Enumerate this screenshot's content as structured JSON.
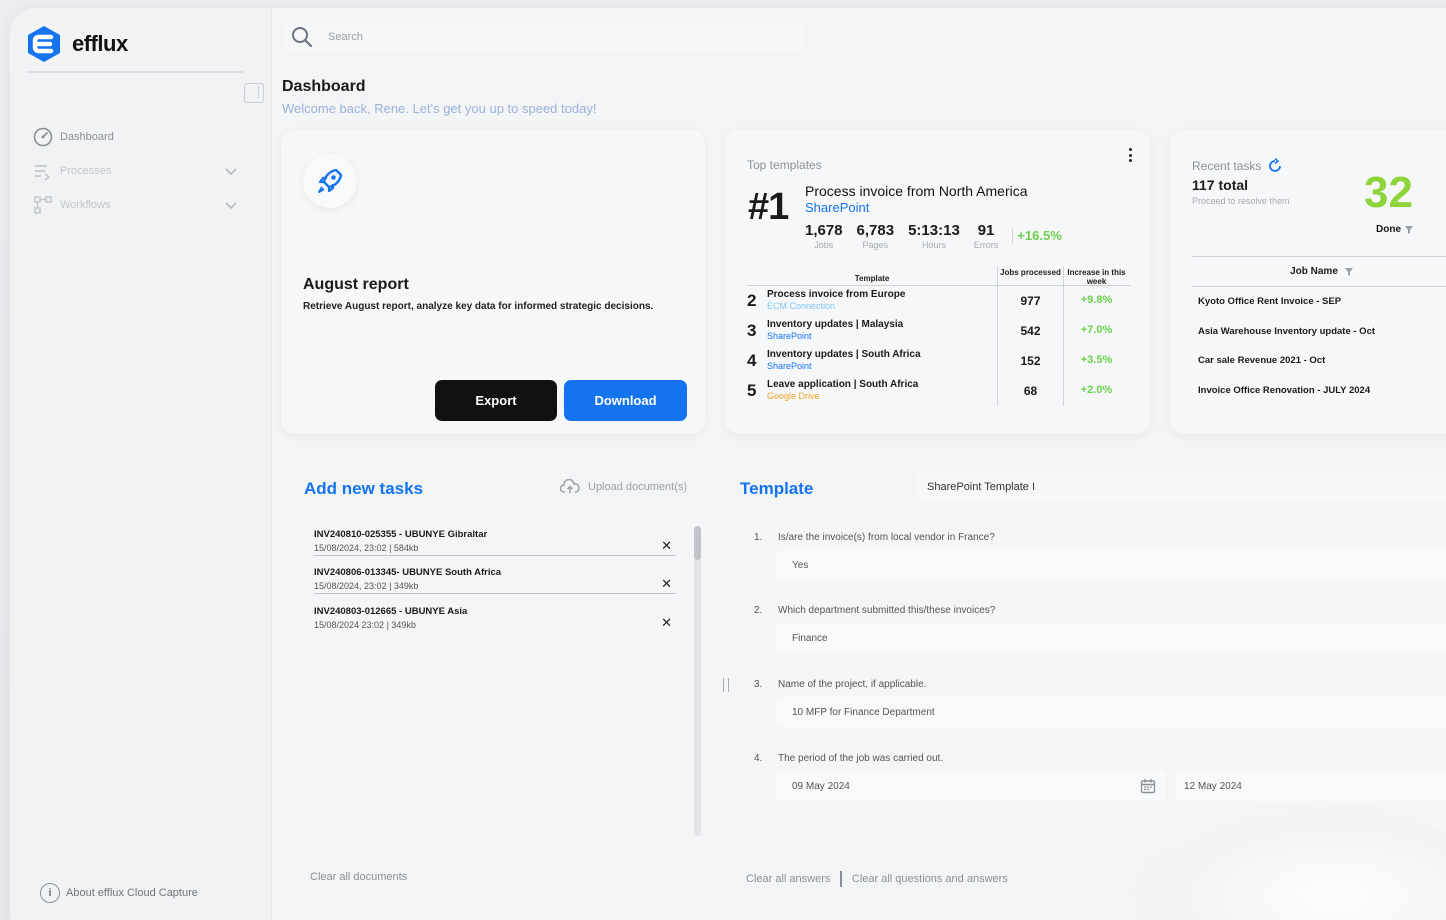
{
  "app": {
    "name": "efflux"
  },
  "colors": {
    "brand": "#1474f0",
    "accent_green": "#8ed43a",
    "increase_green": "#6bd14c",
    "dark_button": "#111111"
  },
  "sidebar": {
    "items": [
      {
        "label": "Dashboard",
        "icon": "dashboard-icon"
      },
      {
        "label": "Processes",
        "icon": "processes-icon"
      },
      {
        "label": "Workflows",
        "icon": "workflows-icon"
      }
    ],
    "about": "About efflux Cloud Capture"
  },
  "search": {
    "placeholder": "Search"
  },
  "header": {
    "title": "Dashboard",
    "subtitle": "Welcome back, Rene. Let's get you up to speed today!"
  },
  "report": {
    "title": "August report",
    "description": "Retrieve August report, analyze key data for informed strategic decisions.",
    "export_label": "Export",
    "download_label": "Download"
  },
  "top_templates": {
    "label": "Top templates",
    "top": {
      "rank": "#1",
      "name": "Process invoice from North America",
      "source": "SharePoint",
      "stats": [
        {
          "value": "1,678",
          "label": "Jobs"
        },
        {
          "value": "6,783",
          "label": "Pages"
        },
        {
          "value": "5:13:13",
          "label": "Hours"
        },
        {
          "value": "91",
          "label": "Errors"
        }
      ],
      "increase": "+16.5%"
    },
    "columns": {
      "template": "Template",
      "jobs": "Jobs processed",
      "increase": "Increase in this week"
    },
    "rows": [
      {
        "rank": "2",
        "name": "Process invoice from Europe",
        "source": "ECM Connection",
        "source_color": "#7fc4f0",
        "jobs": "977",
        "increase": "+9.8%"
      },
      {
        "rank": "3",
        "name": "Inventory updates | Malaysia",
        "source": "SharePoint",
        "source_color": "#1474f0",
        "jobs": "542",
        "increase": "+7.0%"
      },
      {
        "rank": "4",
        "name": "Inventory updates | South Africa",
        "source": "SharePoint",
        "source_color": "#1474f0",
        "jobs": "152",
        "increase": "+3.5%"
      },
      {
        "rank": "5",
        "name": "Leave application | South Africa",
        "source": "Google Drive",
        "source_color": "#f0a623",
        "jobs": "68",
        "increase": "+2.0%"
      }
    ]
  },
  "recent_tasks": {
    "label": "Recent tasks",
    "total": "117 total",
    "subtitle": "Proceed to resolve them",
    "done_count": "32",
    "done_label": "Done",
    "column": "Job Name",
    "rows": [
      "Kyoto Office Rent Invoice - SEP",
      "Asia Warehouse Inventory update - Oct",
      "Car sale Revenue 2021 - Oct",
      "Invoice Office Renovation - JULY 2024"
    ]
  },
  "add_tasks": {
    "title": "Add new tasks",
    "upload_label": "Upload document(s)",
    "documents": [
      {
        "name": "INV240810-025355 - UBUNYE Gibraltar",
        "meta": "15/08/2024, 23:02 | 584kb"
      },
      {
        "name": "INV240806-013345- UBUNYE South Africa",
        "meta": "15/08/2024, 23:02 | 349kb"
      },
      {
        "name": "INV240803-012665 - UBUNYE Asia",
        "meta": "15/08/2024 23:02 | 349kb"
      }
    ],
    "clear_label": "Clear all documents"
  },
  "template_panel": {
    "title": "Template",
    "selected": "SharePoint Template I",
    "questions": [
      {
        "num": "1.",
        "text": "Is/are the invoice(s) from local vendor in France?",
        "answer": "Yes"
      },
      {
        "num": "2.",
        "text": "Which department submitted this/these invoices?",
        "answer": "Finance"
      },
      {
        "num": "3.",
        "text": "Name of the project, if applicable.",
        "answer": "10 MFP for Finance Department"
      },
      {
        "num": "4.",
        "text": "The period of the job was carried out.",
        "answer": "09 May 2024",
        "answer_end": "12 May 2024"
      }
    ],
    "clear_answers": "Clear all answers",
    "clear_all": "Clear all questions and answers"
  }
}
